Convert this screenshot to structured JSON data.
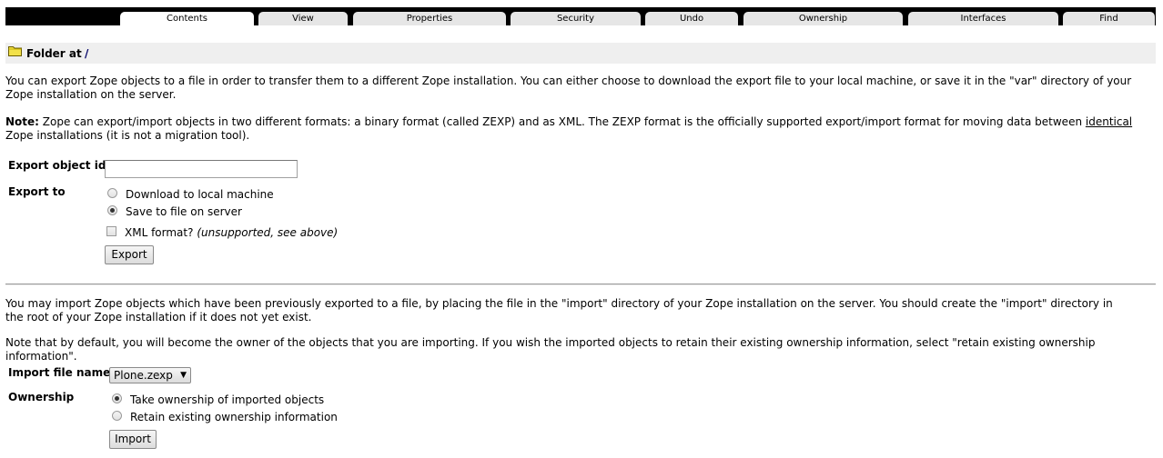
{
  "tabs": [
    {
      "label": "Contents",
      "active": true
    },
    {
      "label": "View"
    },
    {
      "label": "Properties"
    },
    {
      "label": "Security"
    },
    {
      "label": "Undo"
    },
    {
      "label": "Ownership"
    },
    {
      "label": "Interfaces"
    },
    {
      "label": "Find"
    }
  ],
  "location": {
    "label": "Folder at",
    "path": "/",
    "icon": "folder-icon"
  },
  "export_section": {
    "intro": "You can export Zope objects to a file in order to transfer them to a different Zope installation. You can either choose to download the export file to your local machine, or save it in the \"var\" directory of your Zope installation on the server.",
    "note_label": "Note:",
    "note_text_a": " Zope can export/import objects in two different formats: a binary format (called ZEXP) and as XML. The ZEXP format is the officially supported export/import format for moving data between ",
    "note_emphasis": "identical",
    "note_text_b": " Zope installations (it is not a migration tool).",
    "id_label": "Export object id",
    "id_value": "",
    "export_to_label": "Export to",
    "option_download": "Download to local machine",
    "option_server": "Save to file on server",
    "selected_option": "server",
    "xml_label": "XML format?",
    "xml_hint": "(unsupported, see above)",
    "xml_checked": false,
    "button": "Export"
  },
  "import_section": {
    "intro": "You may import Zope objects which have been previously exported to a file, by placing the file in the \"import\" directory of your Zope installation on the server. You should create the \"import\" directory in the root of your Zope installation if it does not yet exist.",
    "note": "Note that by default, you will become the owner of the objects that you are importing. If you wish the imported objects to retain their existing ownership information, select \"retain existing ownership information\".",
    "file_label": "Import file name",
    "file_value": "Plone.zexp",
    "ownership_label": "Ownership",
    "option_take": "Take ownership of imported objects",
    "option_retain": "Retain existing ownership information",
    "selected_option": "take",
    "button": "Import"
  }
}
